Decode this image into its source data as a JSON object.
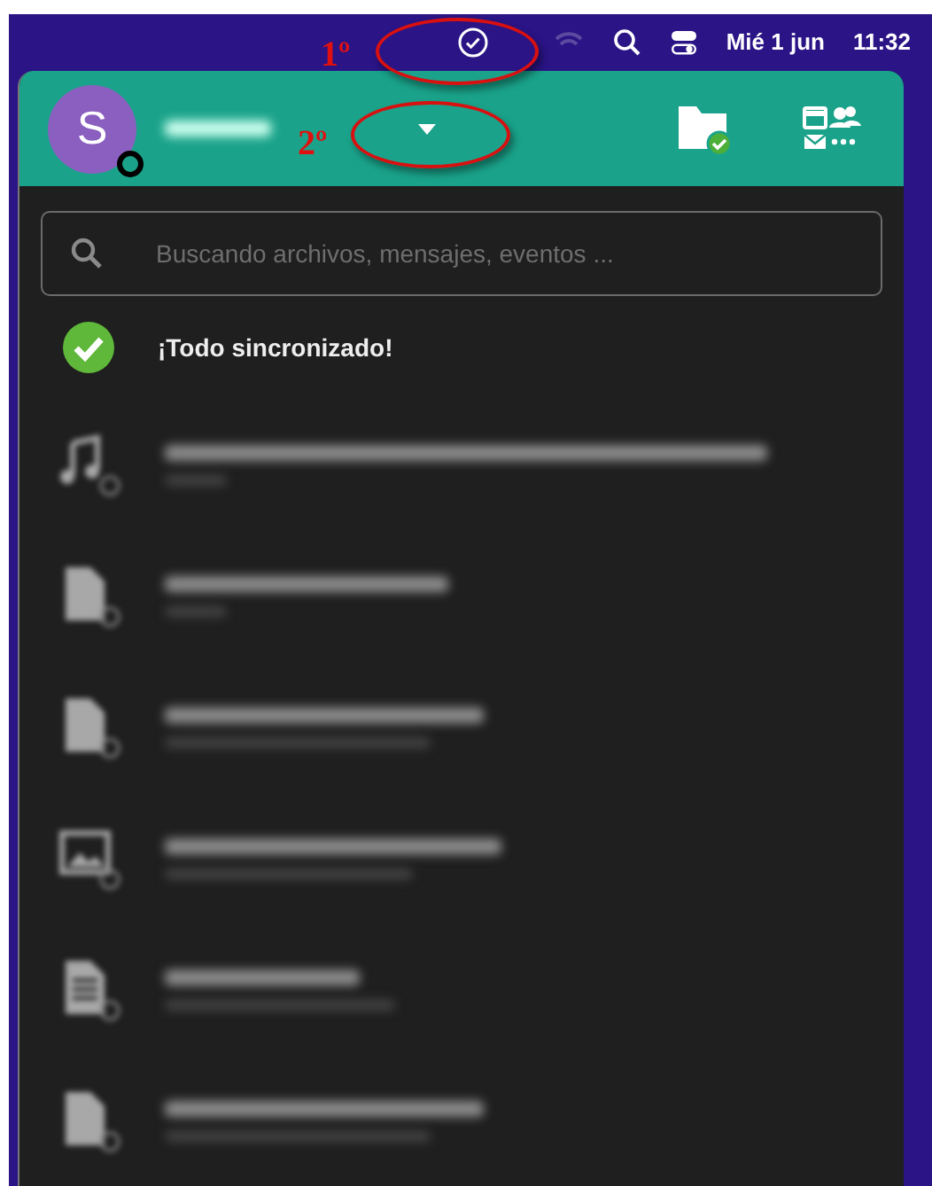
{
  "menu_bar": {
    "date": "Mié 1 jun",
    "time": "11:32"
  },
  "header": {
    "avatar_letter": "S"
  },
  "search": {
    "placeholder": "Buscando archivos, mensajes, eventos ..."
  },
  "sync_status": {
    "text": "¡Todo sincronizado!"
  },
  "activities": [
    {
      "kind": "audio"
    },
    {
      "kind": "file"
    },
    {
      "kind": "file"
    },
    {
      "kind": "image"
    },
    {
      "kind": "text"
    },
    {
      "kind": "file"
    }
  ],
  "annotations": [
    {
      "label": "1º"
    },
    {
      "label": "2º"
    }
  ]
}
